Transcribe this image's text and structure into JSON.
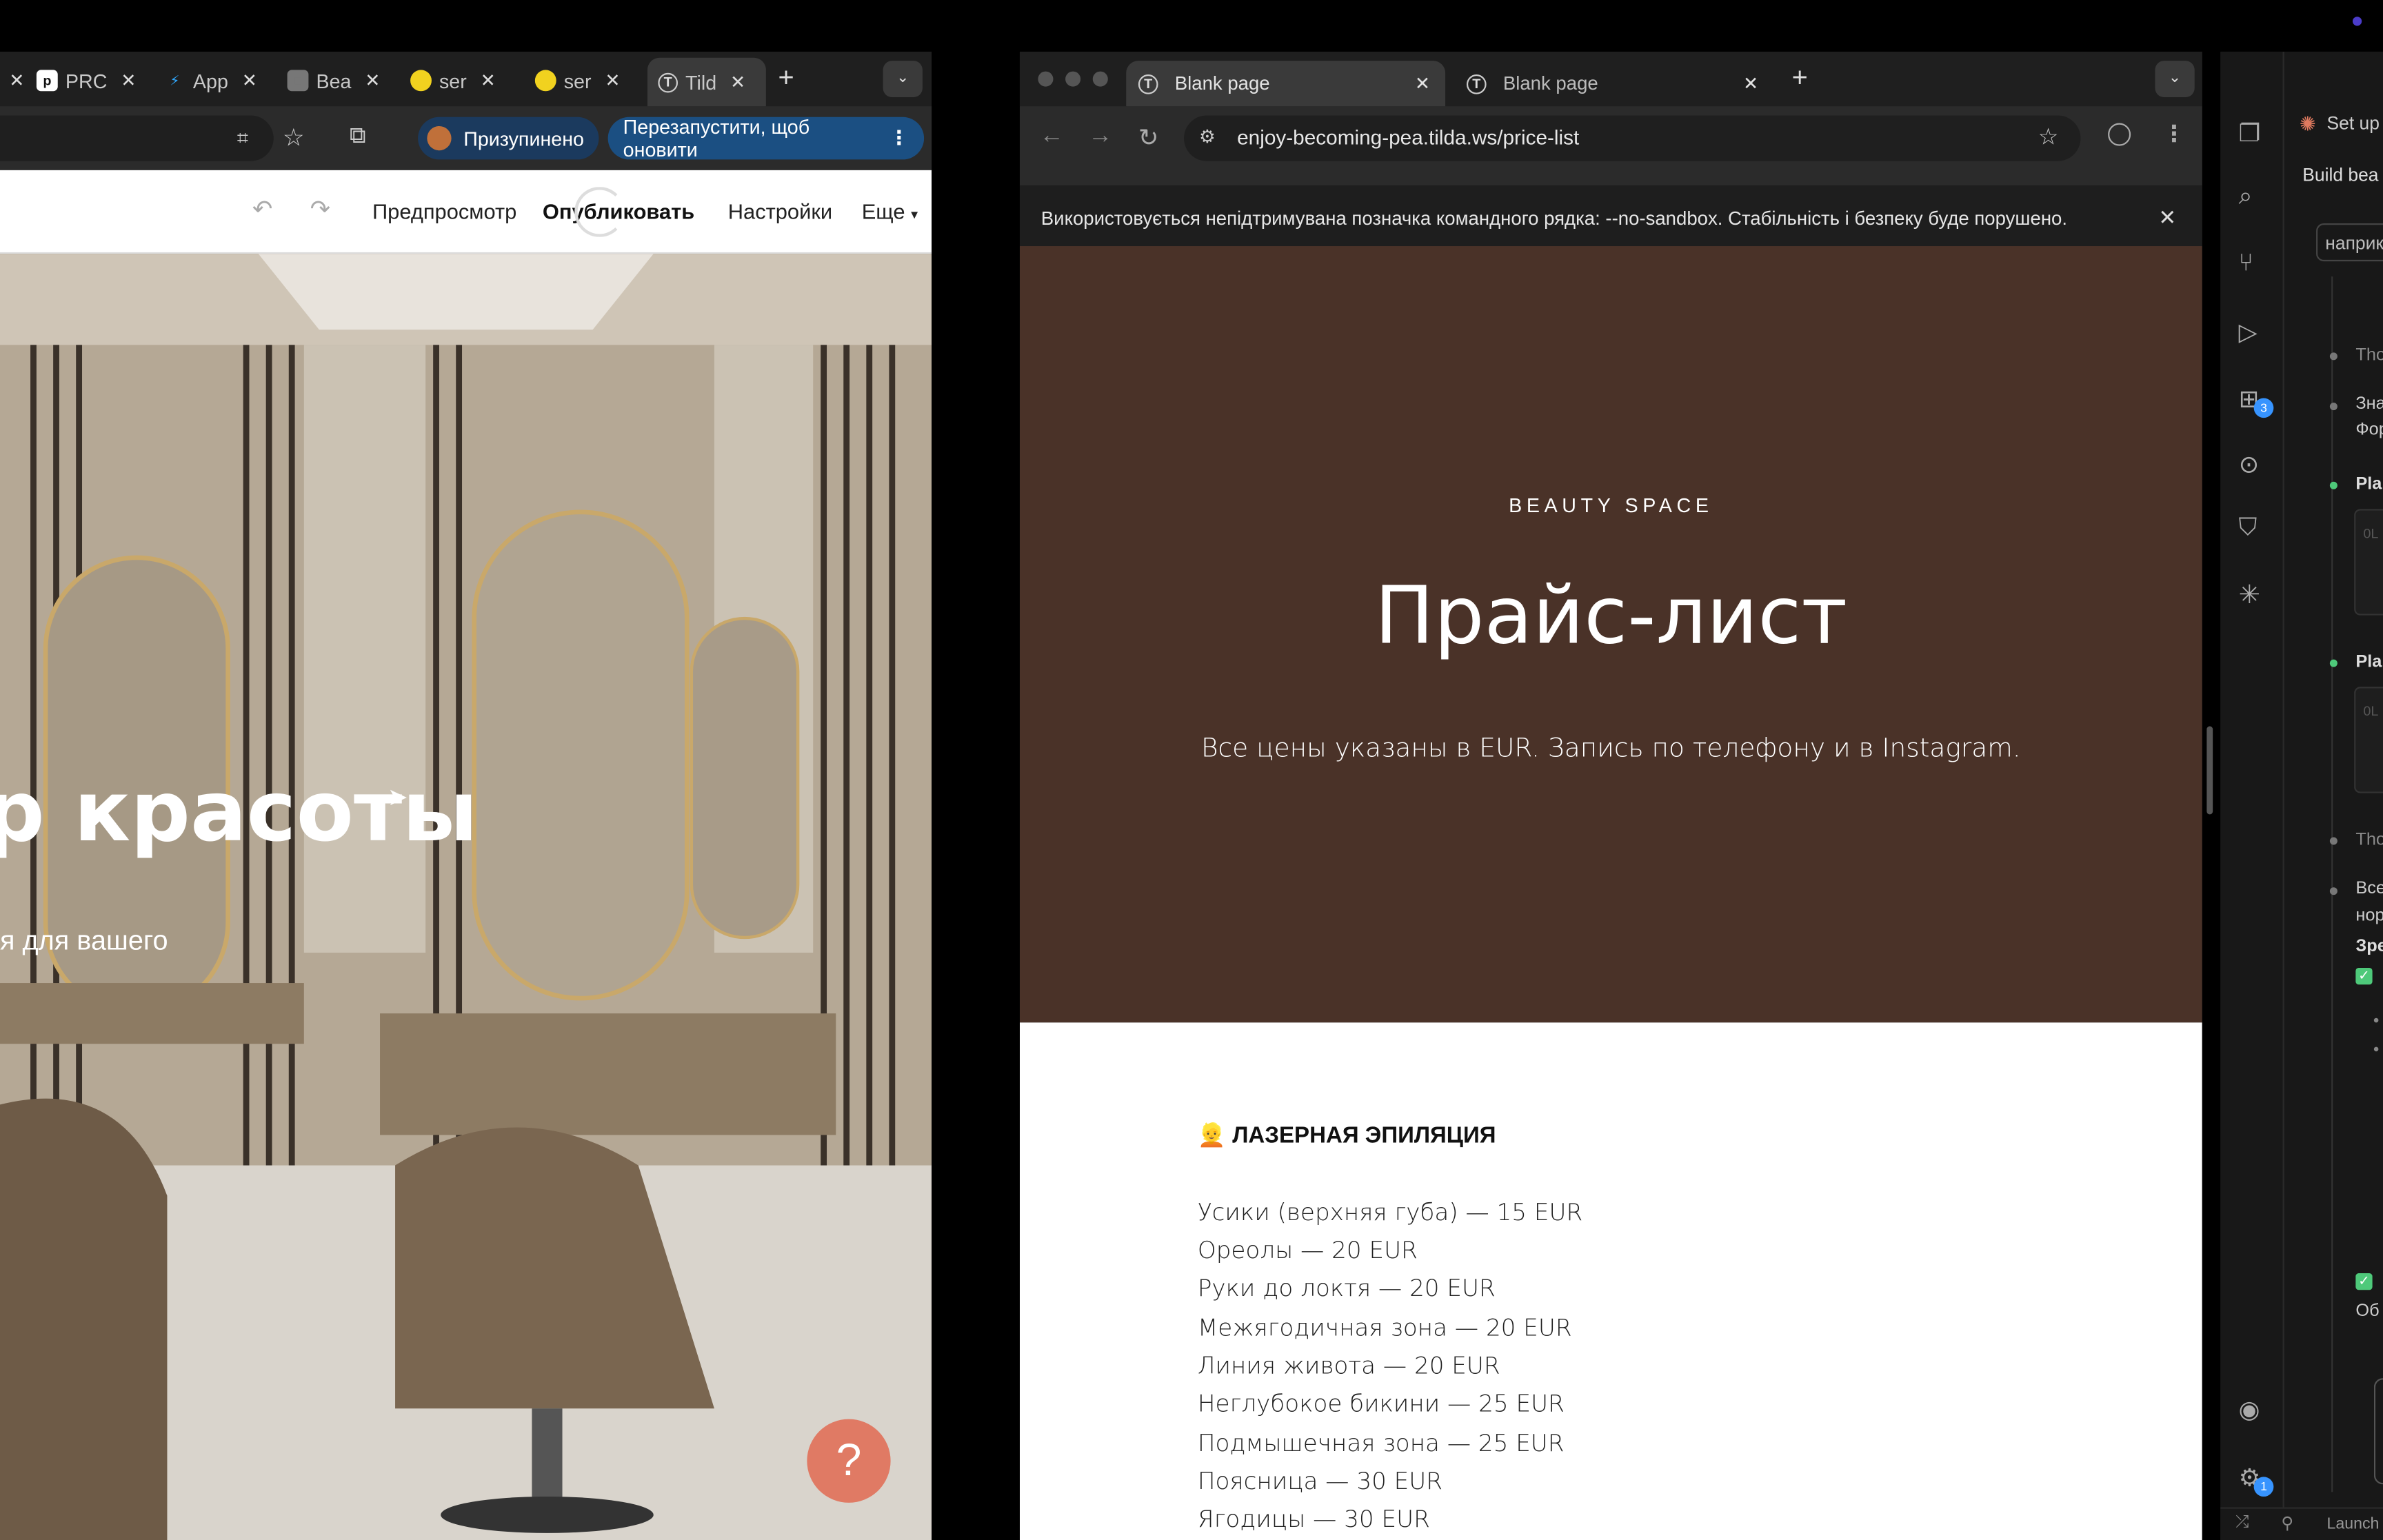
{
  "left_browser": {
    "tabs": [
      {
        "label": "PRC",
        "favicon": "p"
      },
      {
        "label": "App",
        "favicon": "bolt"
      },
      {
        "label": "Bea",
        "favicon": "box"
      },
      {
        "label": "ser",
        "favicon": "yellow-circle"
      },
      {
        "label": "ser",
        "favicon": "yellow-circle"
      },
      {
        "label": "Tild",
        "favicon": "T"
      }
    ],
    "paused_label": "Призупинено",
    "restart_label": "Перезапустити, щоб оновити",
    "tilda_toolbar": {
      "preview": "Предпросмотр",
      "publish": "Опубликовать",
      "settings": "Настройки",
      "more": "Еще"
    },
    "hero": {
      "title_fragment": "р красоты",
      "subtitle_fragment": "я для вашего"
    },
    "help_button": "?"
  },
  "right_browser": {
    "tabs": [
      {
        "label": "Blank page",
        "favicon": "T"
      },
      {
        "label": "Blank page",
        "favicon": "T"
      }
    ],
    "url": "enjoy-becoming-pea.tilda.ws/price-list",
    "infobar_text": "Використовується непідтримувана позначка командного рядка: --no-sandbox. Стабільність і безпеку буде порушено.",
    "hero": {
      "eyebrow": "BEAUTY SPACE",
      "title": "Прайс-лист",
      "subtitle": "Все цены указаны в EUR. Запись по телефону и в Instagram."
    },
    "section_title": "ЛАЗЕРНАЯ ЭПИЛЯЦИЯ",
    "section_emoji": "👱",
    "price_items": [
      "Усики (верхняя губа) — 15 EUR",
      "Ореолы — 20 EUR",
      "Руки до локтя — 20 EUR",
      "Межягодичная зона — 20 EUR",
      "Линия живота — 20 EUR",
      "Неглубокое бикини — 25 EUR",
      "Подмышечная зона — 25 EUR",
      "Поясница — 30 EUR",
      "Ягодицы — 30 EUR"
    ]
  },
  "vscode": {
    "header_fragment": "Set up",
    "subheader_fragment": "Build bea",
    "input_fragment": "наприк",
    "timeline": [
      {
        "text": "Thou"
      },
      {
        "text": "Зна"
      },
      {
        "text": "Фор"
      },
      {
        "text": "Pla"
      },
      {
        "text": "0L"
      },
      {
        "text": "Pla"
      },
      {
        "text": "0L"
      },
      {
        "text": "Thou"
      },
      {
        "text": "Все"
      },
      {
        "text": "нор"
      },
      {
        "text": "Зре"
      },
      {
        "text": "Об"
      }
    ],
    "extensions_badge": "3",
    "settings_badge": "1",
    "status_fragment": "Launch",
    "accent_green": "#4ec97a",
    "badge_blue": "#3794ff"
  }
}
